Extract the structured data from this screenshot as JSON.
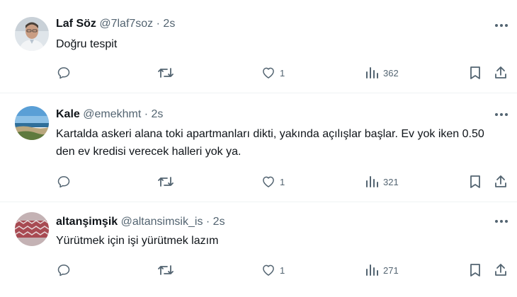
{
  "tweets": [
    {
      "name": "Laf Söz",
      "handle": "@7laf7soz",
      "separator": "·",
      "time": "2s",
      "text": "Doğru tespit",
      "likes": "1",
      "views": "362",
      "avatar": "portrait-photo"
    },
    {
      "name": "Kale",
      "handle": "@emekhmt",
      "separator": "·",
      "time": "2s",
      "text": "Kartalda askeri alana toki apartmanları dikti, yakında açılışlar başlar.  Ev yok iken 0.50 den ev kredisi verecek halleri yok ya.",
      "likes": "1",
      "views": "321",
      "avatar": "beach-landscape"
    },
    {
      "name": "altanşimşik",
      "handle": "@altansimsik_is",
      "separator": "·",
      "time": "2s",
      "text": "Yürütmek için işi yürütmek lazım",
      "likes": "1",
      "views": "271",
      "avatar": "red-pattern"
    }
  ],
  "icons": {
    "more": "more-icon",
    "reply": "reply-icon",
    "retweet": "retweet-icon",
    "like": "heart-icon",
    "views": "analytics-icon",
    "bookmark": "bookmark-icon",
    "share": "share-icon"
  },
  "colors": {
    "text": "#0f1419",
    "secondary": "#536471",
    "divider": "#eff3f4"
  }
}
